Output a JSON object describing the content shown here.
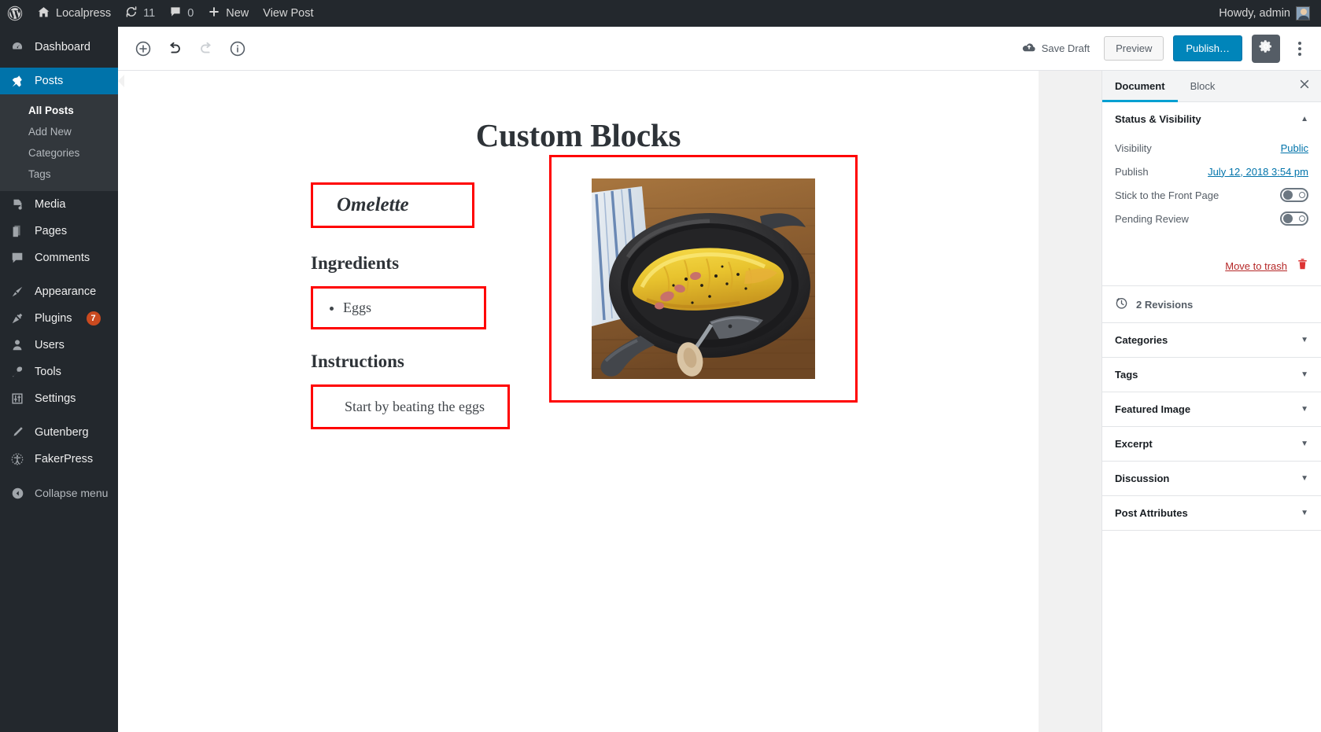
{
  "adminbar": {
    "logo_icon": "wordpress-logo-icon",
    "site_icon": "home-icon",
    "site_name": "Localpress",
    "updates_icon": "updates-icon",
    "updates_count": "11",
    "comments_icon": "comment-bubble-icon",
    "comments_count": "0",
    "new_icon": "plus-icon",
    "new_label": "New",
    "view_post_label": "View Post",
    "howdy": "Howdy, admin",
    "avatar_icon": "user-avatar-icon"
  },
  "adminmenu": {
    "items": [
      {
        "label": "Dashboard",
        "icon": "dashboard-icon",
        "current": false
      },
      {
        "label": "Posts",
        "icon": "pushpin-icon",
        "current": true
      },
      {
        "label": "Media",
        "icon": "media-icon",
        "current": false
      },
      {
        "label": "Pages",
        "icon": "pages-icon",
        "current": false
      },
      {
        "label": "Comments",
        "icon": "comment-bubble-icon",
        "current": false
      },
      {
        "label": "Appearance",
        "icon": "paintbrush-icon",
        "current": false
      },
      {
        "label": "Plugins",
        "icon": "plug-icon",
        "current": false,
        "badge": "7"
      },
      {
        "label": "Users",
        "icon": "user-icon",
        "current": false
      },
      {
        "label": "Tools",
        "icon": "wrench-icon",
        "current": false
      },
      {
        "label": "Settings",
        "icon": "sliders-icon",
        "current": false
      },
      {
        "label": "Gutenberg",
        "icon": "pencil-icon",
        "current": false
      },
      {
        "label": "FakerPress",
        "icon": "accessibility-icon",
        "current": false
      }
    ],
    "submenu": [
      {
        "label": "All Posts",
        "current": true
      },
      {
        "label": "Add New",
        "current": false
      },
      {
        "label": "Categories",
        "current": false
      },
      {
        "label": "Tags",
        "current": false
      }
    ],
    "collapse_label": "Collapse menu",
    "collapse_icon": "collapse-arrow-icon"
  },
  "editor_header": {
    "add_block_icon": "add-block-plus-icon",
    "undo_icon": "undo-arrow-icon",
    "redo_icon": "redo-arrow-icon",
    "info_icon": "content-info-icon",
    "save_draft_icon": "cloud-upload-icon",
    "save_draft_label": "Save Draft",
    "preview_label": "Preview",
    "publish_label": "Publish…",
    "settings_gear_icon": "gear-icon",
    "more_menu_icon": "kebab-vertical-icon"
  },
  "post": {
    "title": "Custom Blocks",
    "recipe_name": "Omelette",
    "ingredients_heading": "Ingredients",
    "ingredients": [
      "Eggs"
    ],
    "instructions_heading": "Instructions",
    "instructions": "Start by beating the eggs",
    "image_alt": "Omelette cooking in a black frying pan on a wooden table"
  },
  "settings_sidebar": {
    "tabs": [
      {
        "label": "Document",
        "active": true
      },
      {
        "label": "Block",
        "active": false
      }
    ],
    "close_icon": "close-x-icon",
    "status_panel": {
      "title": "Status & Visibility",
      "collapse_icon": "caret-up-icon",
      "visibility_label": "Visibility",
      "visibility_value": "Public",
      "publish_label": "Publish",
      "publish_value": "July 12, 2018 3:54 pm",
      "sticky_label": "Stick to the Front Page",
      "sticky_on": false,
      "pending_label": "Pending Review",
      "pending_on": false,
      "trash_label": "Move to trash",
      "trash_icon": "trash-can-icon"
    },
    "revisions": {
      "icon": "revisions-clock-icon",
      "label": "2 Revisions"
    },
    "panels": [
      {
        "label": "Categories",
        "icon": "caret-down-icon"
      },
      {
        "label": "Tags",
        "icon": "caret-down-icon"
      },
      {
        "label": "Featured Image",
        "icon": "caret-down-icon"
      },
      {
        "label": "Excerpt",
        "icon": "caret-down-icon"
      },
      {
        "label": "Discussion",
        "icon": "caret-down-icon"
      },
      {
        "label": "Post Attributes",
        "icon": "caret-down-icon"
      }
    ]
  },
  "colors": {
    "admin_bg": "#23282d",
    "accent_blue": "#0073aa",
    "publish_blue": "#0085ba",
    "tab_underline": "#00a0d2",
    "block_outline_red": "#ff0000",
    "trash_red": "#b52727",
    "badge_orange": "#ca4a1f"
  }
}
